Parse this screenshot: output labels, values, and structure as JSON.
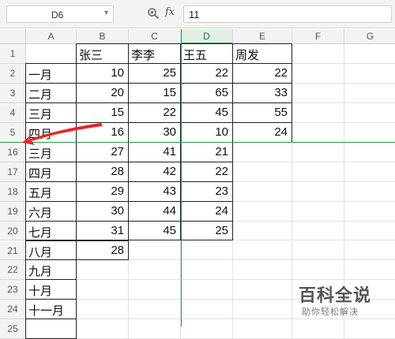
{
  "formula_bar": {
    "cell_ref": "D6",
    "fx_label": "fx",
    "value": "11"
  },
  "columns": [
    "A",
    "B",
    "C",
    "D",
    "E",
    "F",
    "G"
  ],
  "selected_column": "D",
  "rows": [
    {
      "num": "1",
      "a": "",
      "b": "张三",
      "c": "李李",
      "d": "王五",
      "e": "周发"
    },
    {
      "num": "2",
      "a": "一月",
      "b": "10",
      "c": "25",
      "d": "22",
      "e": "22"
    },
    {
      "num": "3",
      "a": "二月",
      "b": "20",
      "c": "15",
      "d": "65",
      "e": "33"
    },
    {
      "num": "4",
      "a": "三月",
      "b": "15",
      "c": "22",
      "d": "45",
      "e": "55"
    },
    {
      "num": "5",
      "a": "四月",
      "b": "16",
      "c": "30",
      "d": "10",
      "e": "24"
    },
    {
      "num": "16",
      "a": "三月",
      "b": "27",
      "c": "41",
      "d": "21",
      "e": ""
    },
    {
      "num": "17",
      "a": "四月",
      "b": "28",
      "c": "42",
      "d": "22",
      "e": ""
    },
    {
      "num": "18",
      "a": "五月",
      "b": "29",
      "c": "43",
      "d": "23",
      "e": ""
    },
    {
      "num": "19",
      "a": "六月",
      "b": "30",
      "c": "44",
      "d": "24",
      "e": ""
    },
    {
      "num": "20",
      "a": "七月",
      "b": "31",
      "c": "45",
      "d": "25",
      "e": ""
    },
    {
      "num": "21",
      "a": "八月",
      "b": "28",
      "c": "",
      "d": "",
      "e": ""
    },
    {
      "num": "22",
      "a": "九月",
      "b": "",
      "c": "",
      "d": "",
      "e": ""
    },
    {
      "num": "23",
      "a": "十月",
      "b": "",
      "c": "",
      "d": "",
      "e": ""
    },
    {
      "num": "24",
      "a": "十一月",
      "b": "",
      "c": "",
      "d": "",
      "e": ""
    },
    {
      "num": "25",
      "a": "",
      "b": "",
      "c": "",
      "d": "",
      "e": ""
    }
  ],
  "watermark": {
    "title": "百科全说",
    "subtitle": "助你轻松解决"
  },
  "colors": {
    "freeze_line": "#2a9a4a",
    "arrow": "#e8262a",
    "border": "#222222"
  }
}
